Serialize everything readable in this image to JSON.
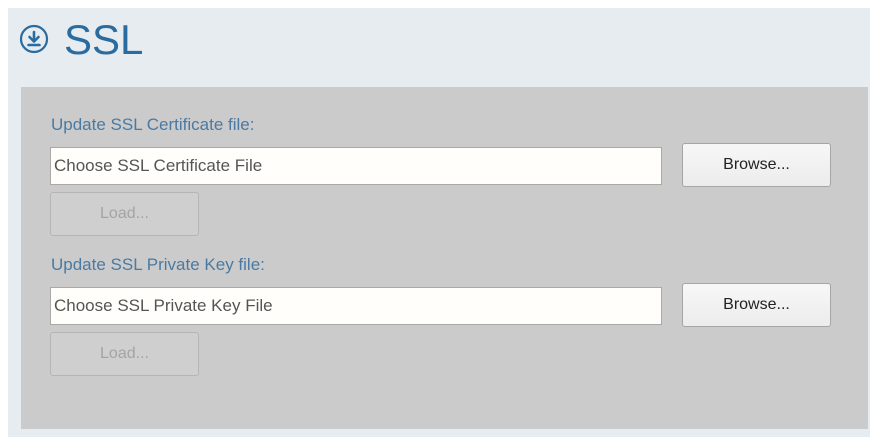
{
  "header": {
    "title": "SSL",
    "icon": "download-circle-icon",
    "accent_color": "#2b6ca0"
  },
  "certificate": {
    "label": "Update SSL Certificate file:",
    "placeholder": "Choose SSL Certificate File",
    "browse_label": "Browse...",
    "load_label": "Load..."
  },
  "private_key": {
    "label": "Update SSL Private Key file:",
    "placeholder": "Choose SSL Private Key File",
    "browse_label": "Browse...",
    "load_label": "Load..."
  }
}
